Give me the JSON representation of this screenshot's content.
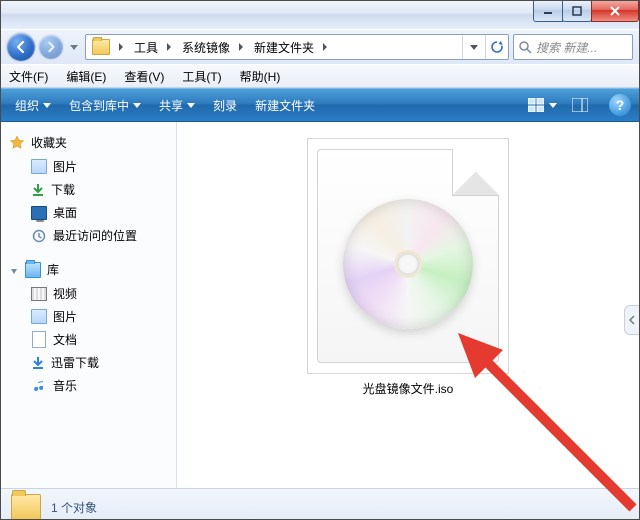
{
  "window": {
    "minimize": "–",
    "maximize": "☐",
    "close": "×"
  },
  "address": {
    "segments": [
      "工具",
      "系统镜像",
      "新建文件夹"
    ]
  },
  "search": {
    "placeholder": "搜索 新建..."
  },
  "menubar": {
    "file": "文件(F)",
    "edit": "编辑(E)",
    "view": "查看(V)",
    "tools": "工具(T)",
    "help": "帮助(H)"
  },
  "cmdbar": {
    "organize": "组织",
    "include": "包含到库中",
    "share": "共享",
    "burn": "刻录",
    "newfolder": "新建文件夹"
  },
  "nav": {
    "favorites": {
      "label": "收藏夹",
      "pictures": "图片",
      "downloads": "下载",
      "desktop": "桌面",
      "recent": "最近访问的位置"
    },
    "libraries": {
      "label": "库",
      "videos": "视频",
      "pictures": "图片",
      "documents": "文档",
      "xunlei": "迅雷下载",
      "music": "音乐"
    }
  },
  "content": {
    "file1_name": "光盘镜像文件.iso"
  },
  "status": {
    "text": "1 个对象"
  }
}
